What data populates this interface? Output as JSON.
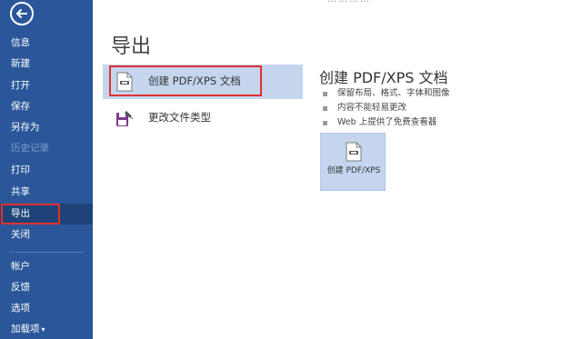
{
  "sidebar": {
    "back_icon": "back-arrow-icon",
    "items": [
      {
        "label": "信息"
      },
      {
        "label": "新建"
      },
      {
        "label": "打开"
      },
      {
        "label": "保存"
      },
      {
        "label": "另存为"
      },
      {
        "label": "历史记录"
      },
      {
        "label": "打印"
      },
      {
        "label": "共享"
      },
      {
        "label": "导出"
      },
      {
        "label": "关闭"
      },
      {
        "label": "帐户"
      },
      {
        "label": "反馈"
      },
      {
        "label": "选项"
      },
      {
        "label": "加载项"
      }
    ],
    "selected": "导出",
    "colors": {
      "background": "#2b579a",
      "selected": "#1e4379"
    }
  },
  "top_partial_text": "…………",
  "main": {
    "title": "导出",
    "options": [
      {
        "label": "创建 PDF/XPS 文档",
        "icon": "pdf-document-icon",
        "selected": true
      },
      {
        "label": "更改文件类型",
        "icon": "change-file-type-icon",
        "selected": false
      }
    ],
    "detail": {
      "title": "创建 PDF/XPS 文档",
      "bullets": [
        "保留布局、格式、字体和图像",
        "内容不能轻易更改",
        "Web 上提供了免费查看器"
      ],
      "button_label": "创建 PDF/XPS",
      "button_icon": "pdf-document-icon"
    }
  },
  "highlight_color": "#e0312e"
}
